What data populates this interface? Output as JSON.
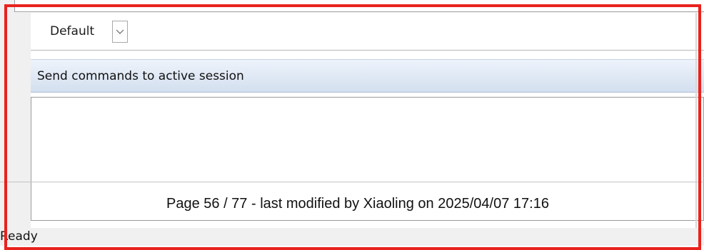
{
  "session_dropdown": {
    "selected": "Default",
    "chevron_icon": "chevron-down-icon"
  },
  "command_panel": {
    "title": "Send commands to active session",
    "input_value": ""
  },
  "page_footer": {
    "text": "Page 56 / 77 - last modified by Xiaoling on 2025/04/07 17:16"
  },
  "status_bar": {
    "text": "Ready"
  },
  "colors": {
    "highlight": "#e8221d",
    "header_gradient_top": "#eef3fb",
    "header_gradient_bottom": "#d3dfef"
  }
}
